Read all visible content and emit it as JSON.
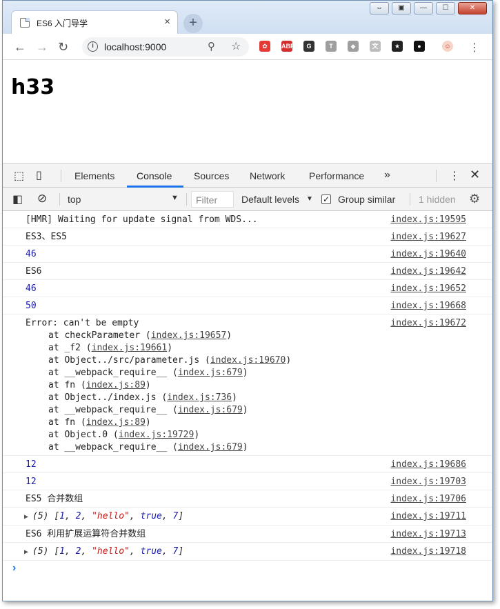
{
  "browser": {
    "tab_title": "ES6 入门导学",
    "tab_close": "×",
    "new_tab": "+",
    "url": "localhost:9000",
    "window_buttons": [
      "⇔",
      "▣",
      "—",
      "☐",
      "✕"
    ]
  },
  "extensions": [
    {
      "name": "extension-red-icon",
      "color": "#e53935",
      "label": "✿"
    },
    {
      "name": "adblock-icon",
      "color": "#d32f2f",
      "label": "ABP"
    },
    {
      "name": "grammarly-icon",
      "color": "#333333",
      "label": "G"
    },
    {
      "name": "text-extension-icon",
      "color": "#9e9e9e",
      "label": "T"
    },
    {
      "name": "diamond-extension-icon",
      "color": "#9e9e9e",
      "label": "◆"
    },
    {
      "name": "translate-extension-icon",
      "color": "#bdbdbd",
      "label": "文"
    },
    {
      "name": "star-extension-icon",
      "color": "#222222",
      "label": "★"
    },
    {
      "name": "circle-extension-icon",
      "color": "#111111",
      "label": "●"
    }
  ],
  "page": {
    "heading": "h33"
  },
  "devtools": {
    "tabs": [
      "Elements",
      "Console",
      "Sources",
      "Network",
      "Performance"
    ],
    "active_tab": "Console",
    "more": "»",
    "context": "top",
    "filter_placeholder": "Filter",
    "levels": "Default levels",
    "group_similar": "Group similar",
    "hidden": "1 hidden"
  },
  "console": {
    "rows": [
      {
        "type": "text",
        "msg": "[HMR] Waiting for update signal from WDS...",
        "src": "index.js:19595"
      },
      {
        "type": "text",
        "msg": "ES3、ES5",
        "src": "index.js:19627"
      },
      {
        "type": "num",
        "msg": "46",
        "src": "index.js:19640"
      },
      {
        "type": "text",
        "msg": "ES6",
        "src": "index.js:19642"
      },
      {
        "type": "num",
        "msg": "46",
        "src": "index.js:19652"
      },
      {
        "type": "num",
        "msg": "50",
        "src": "index.js:19668"
      },
      {
        "type": "error",
        "msg": "Error: can't be empty",
        "src": "index.js:19672",
        "trace": [
          {
            "pre": "at checkParameter (",
            "link": "index.js:19657",
            "post": ")"
          },
          {
            "pre": "at _f2 (",
            "link": "index.js:19661",
            "post": ")"
          },
          {
            "pre": "at Object../src/parameter.js (",
            "link": "index.js:19670",
            "post": ")"
          },
          {
            "pre": "at __webpack_require__ (",
            "link": "index.js:679",
            "post": ")"
          },
          {
            "pre": "at fn (",
            "link": "index.js:89",
            "post": ")"
          },
          {
            "pre": "at Object../index.js (",
            "link": "index.js:736",
            "post": ")"
          },
          {
            "pre": "at __webpack_require__ (",
            "link": "index.js:679",
            "post": ")"
          },
          {
            "pre": "at fn (",
            "link": "index.js:89",
            "post": ")"
          },
          {
            "pre": "at Object.0 (",
            "link": "index.js:19729",
            "post": ")"
          },
          {
            "pre": "at __webpack_require__ (",
            "link": "index.js:679",
            "post": ")"
          }
        ]
      },
      {
        "type": "num",
        "msg": "12",
        "src": "index.js:19686"
      },
      {
        "type": "num",
        "msg": "12",
        "src": "index.js:19703"
      },
      {
        "type": "text",
        "msg": "ES5 合并数组",
        "src": "index.js:19706"
      },
      {
        "type": "array",
        "count": "(5)",
        "open": "[",
        "items": [
          "1",
          "2",
          "\"hello\"",
          "true",
          "7"
        ],
        "close": "]",
        "src": "index.js:19711"
      },
      {
        "type": "text",
        "msg": "ES6 利用扩展运算符合并数组",
        "src": "index.js:19713"
      },
      {
        "type": "array",
        "count": "(5)",
        "open": "[",
        "items": [
          "1",
          "2",
          "\"hello\"",
          "true",
          "7"
        ],
        "close": "]",
        "src": "index.js:19718"
      }
    ],
    "prompt": "›"
  }
}
